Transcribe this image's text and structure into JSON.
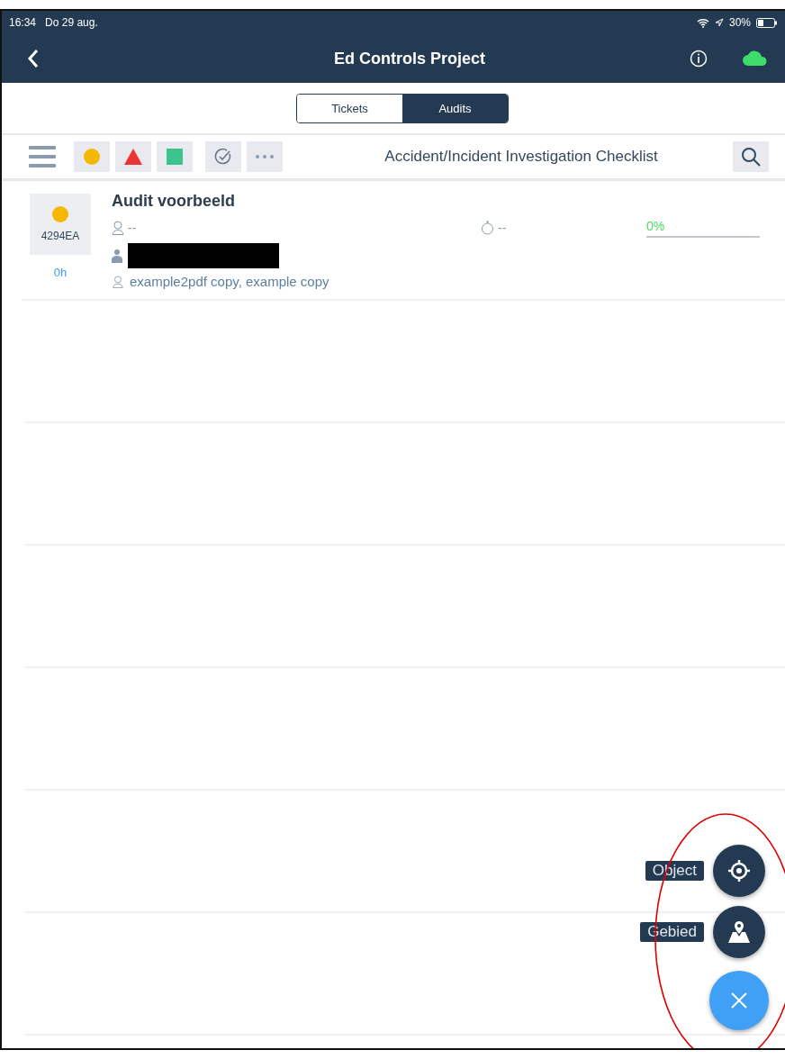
{
  "status_bar": {
    "time": "16:34",
    "date": "Do 29 aug.",
    "battery": "30%"
  },
  "nav": {
    "title": "Ed Controls Project",
    "synced": true
  },
  "tabs": [
    {
      "label": "Tickets",
      "selected": false
    },
    {
      "label": "Audits",
      "selected": true
    }
  ],
  "toolbar": {
    "filters": [
      {
        "kind": "circle",
        "color": "#f5b800"
      },
      {
        "kind": "triangle",
        "color": "#ee3333"
      },
      {
        "kind": "square",
        "color": "#3cc48e"
      },
      {
        "kind": "check"
      },
      {
        "kind": "more"
      }
    ],
    "title": "Accident/Incident Investigation Checklist"
  },
  "audits": [
    {
      "color": "#f5b800",
      "code": "4294EA",
      "hours": "0h",
      "title": "Audit voorbeeld",
      "assignee": "--",
      "timer": "--",
      "progress": "0%",
      "level": 0,
      "redacted": true,
      "people": "example2pdf copy, example copy"
    }
  ],
  "fab_actions": [
    {
      "kind": "object",
      "label": "Object"
    },
    {
      "kind": "area",
      "label": "Gebied"
    }
  ],
  "annotation": {
    "kind": "ellipse",
    "color": "#e00000"
  }
}
